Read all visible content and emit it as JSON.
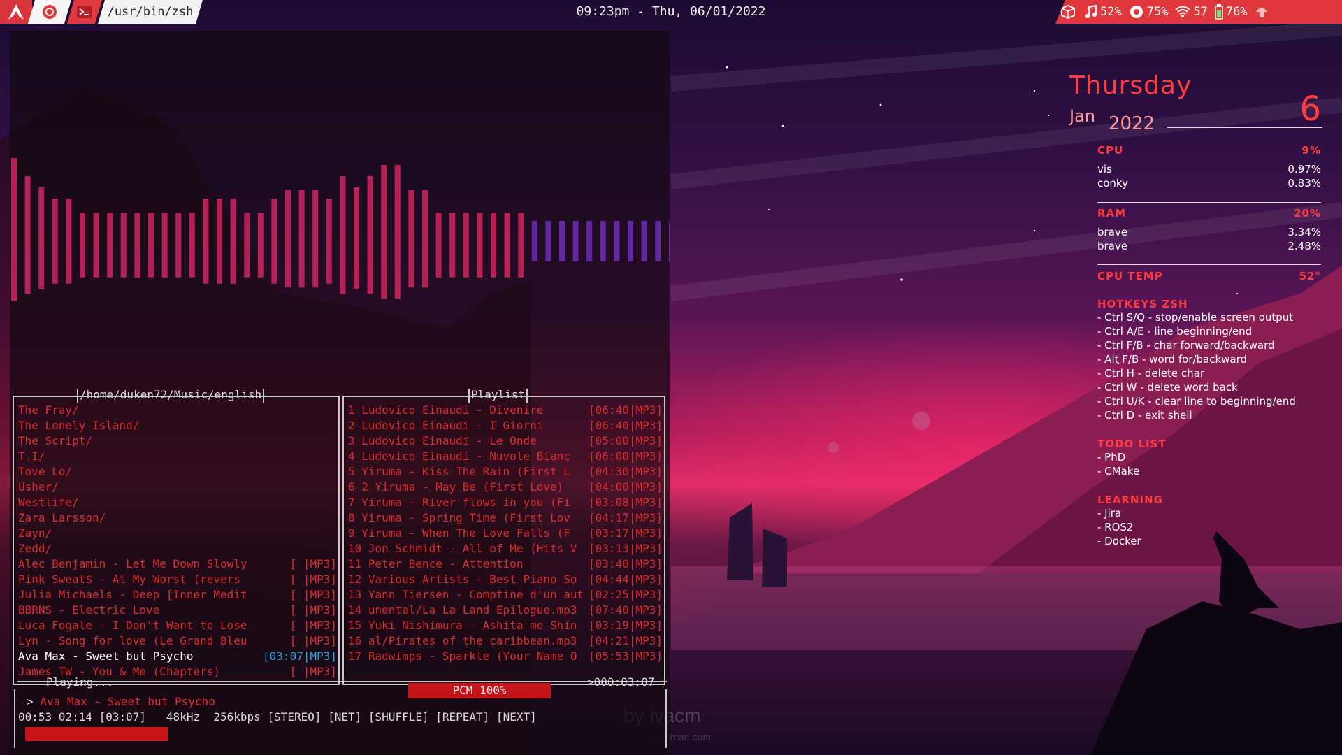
{
  "topbar": {
    "path": "/usr/bin/zsh",
    "clock": "09:23pm - Thu, 06/01/2022",
    "stats": [
      {
        "icon": "music-note-icon",
        "value": "52%"
      },
      {
        "icon": "brightness-icon",
        "value": "75%"
      },
      {
        "icon": "wifi-icon",
        "value": "57"
      },
      {
        "icon": "battery-icon",
        "value": "76%"
      }
    ]
  },
  "visualizer": {
    "levels": [
      0.71,
      0.58,
      0.5,
      0.42,
      0.42,
      0.32,
      0.32,
      0.32,
      0.32,
      0.32,
      0.32,
      0.32,
      0.32,
      0.32,
      0.42,
      0.42,
      0.42,
      0.32,
      0.32,
      0.42,
      0.48,
      0.48,
      0.48,
      0.42,
      0.58,
      0.5,
      0.58,
      0.66,
      0.66,
      0.48,
      0.48,
      0.32,
      0.32,
      0.32,
      0.32,
      0.32,
      0.32,
      0.32,
      0.2,
      0.2,
      0.2,
      0.2,
      0.2,
      0.2,
      0.2,
      0.2,
      0.2,
      0.2,
      0.2
    ]
  },
  "browser": {
    "title": "/home/duken72/Music/english",
    "items": [
      {
        "name": "The Fray/",
        "meta": ""
      },
      {
        "name": "The Lonely Island/",
        "meta": ""
      },
      {
        "name": "The Script/",
        "meta": ""
      },
      {
        "name": "T.I/",
        "meta": ""
      },
      {
        "name": "Tove Lo/",
        "meta": ""
      },
      {
        "name": "Usher/",
        "meta": ""
      },
      {
        "name": "Westlife/",
        "meta": ""
      },
      {
        "name": "Zara Larsson/",
        "meta": ""
      },
      {
        "name": "Zayn/",
        "meta": ""
      },
      {
        "name": "Zedd/",
        "meta": ""
      },
      {
        "name": "Alec Benjamin - Let Me Down Slowly",
        "meta": "[     |MP3]"
      },
      {
        "name": "Pink Sweat$ - At My Worst (revers",
        "meta": "[     |MP3]"
      },
      {
        "name": "Julia Michaels - Deep [Inner Medit",
        "meta": "[     |MP3]"
      },
      {
        "name": "BBRNS - Electric Love",
        "meta": "[     |MP3]"
      },
      {
        "name": "Luca Fogale - I Don't Want to Lose",
        "meta": "[     |MP3]"
      },
      {
        "name": "Lyn - Song for love (Le Grand Bleu",
        "meta": "[     |MP3]"
      },
      {
        "name": "Ava Max - Sweet but Psycho",
        "meta": "[03:07|MP3]",
        "selected": true
      },
      {
        "name": "James TW - You & Me (Chapters)",
        "meta": "[     |MP3]"
      }
    ]
  },
  "playlist": {
    "title": "Playlist",
    "items": [
      {
        "n": "1",
        "name": "Ludovico Einaudi - Divenire",
        "meta": "[06:40|MP3]"
      },
      {
        "n": "2",
        "name": "Ludovico Einaudi - I Giorni",
        "meta": "[06:40|MP3]"
      },
      {
        "n": "3",
        "name": "Ludovico Einaudi - Le Onde",
        "meta": "[05:00|MP3]"
      },
      {
        "n": "4",
        "name": "Ludovico Einaudi - Nuvole Bianc",
        "meta": "[06:00|MP3]"
      },
      {
        "n": "5",
        "name": "Yiruma - Kiss The Rain (First L",
        "meta": "[04:30|MP3]"
      },
      {
        "n": "6",
        "name": "2 Yiruma - May Be (First Love)",
        "meta": "[04:00|MP3]"
      },
      {
        "n": "7",
        "name": "Yiruma - River flows in you (Fi",
        "meta": "[03:08|MP3]"
      },
      {
        "n": "8",
        "name": "Yiruma - Spring Time (First Lov",
        "meta": "[04:17|MP3]"
      },
      {
        "n": "9",
        "name": "Yiruma - When The Love Falls (F",
        "meta": "[03:17|MP3]"
      },
      {
        "n": "10",
        "name": "Jon Schmidt - All of Me (Hits V",
        "meta": "[03:13|MP3]"
      },
      {
        "n": "11",
        "name": "Peter Bence - Attention",
        "meta": "[03:40|MP3]"
      },
      {
        "n": "12",
        "name": "Various Artists - Best Piano So",
        "meta": "[04:44|MP3]"
      },
      {
        "n": "13",
        "name": "Yann Tiersen - Comptine d'un aut",
        "meta": "[02:25|MP3]"
      },
      {
        "n": "14",
        "name": "unental/La La Land Epilogue.mp3",
        "meta": "[07:40|MP3]"
      },
      {
        "n": "15",
        "name": "Yuki Nishimura - Ashita mo Shin",
        "meta": "[03:19|MP3]"
      },
      {
        "n": "16",
        "name": "al/Pirates of the caribbean.mp3",
        "meta": "[04:21|MP3]"
      },
      {
        "n": "17",
        "name": "Radwimps - Sparkle (Your Name O",
        "meta": "[05:53|MP3]"
      }
    ]
  },
  "status": {
    "state": "Playing...",
    "pcm": "PCM 100%",
    "remaining": ">000:03:07",
    "now_playing_prefix": ">",
    "now_playing": "Ava Max - Sweet but Psycho",
    "info_line": "00:53 02:14 [03:07]   48kHz  256kbps [STEREO] [NET] [SHUFFLE] [REPEAT] [NEXT]",
    "progress": 0.28
  },
  "conky": {
    "day": "Thursday",
    "month": "Jan",
    "year": "2022",
    "daynum": "6",
    "cpu": {
      "label": "CPU",
      "value": "9%",
      "procs": [
        {
          "name": "vis",
          "val": "0.97%"
        },
        {
          "name": "conky",
          "val": "0.83%"
        }
      ]
    },
    "ram": {
      "label": "RAM",
      "value": "20%",
      "procs": [
        {
          "name": "brave",
          "val": "3.34%"
        },
        {
          "name": "brave",
          "val": "2.48%"
        }
      ]
    },
    "temp": {
      "label": "CPU TEMP",
      "value": "52°"
    },
    "hotkeys": {
      "label": "HOTKEYS ZSH",
      "items": [
        "- Ctrl S/Q - stop/enable screen output",
        "- Ctrl A/E - line beginning/end",
        "- Ctrl F/B - char forward/backward",
        "- Alt F/B - word for/backward",
        "- Ctrl H - delete char",
        "- Ctrl W - delete word back",
        "- Ctrl U/K - clear line to beginning/end",
        "- Ctrl D - exit shell"
      ]
    },
    "todo": {
      "label": "TODO LIST",
      "items": [
        "- PhD",
        "- CMake"
      ]
    },
    "learning": {
      "label": "LEARNING",
      "items": [
        "- Jira",
        "- ROS2",
        "- Docker"
      ]
    }
  },
  "wallpaper": {
    "credit": "by ivacm",
    "credit_sub": "...smart.com"
  },
  "colors": {
    "accent": "#e0383c",
    "text_red": "#d82c30",
    "selected": "#2aa3d6"
  }
}
